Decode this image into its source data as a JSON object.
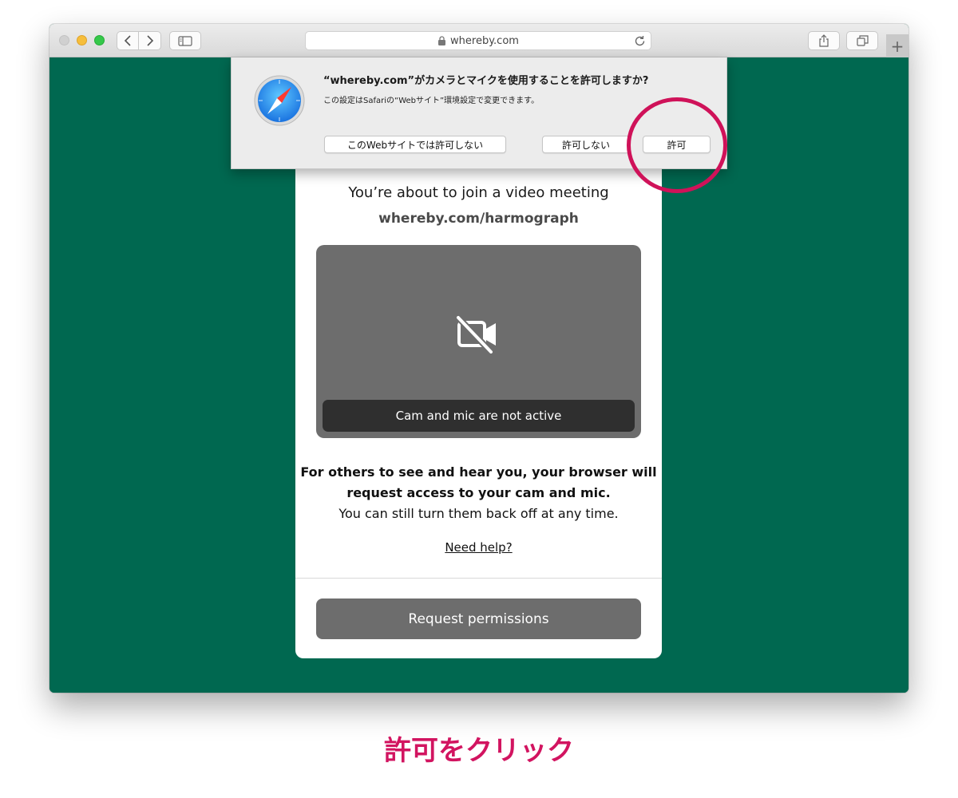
{
  "browser": {
    "address": "whereby.com",
    "new_tab_label": "+"
  },
  "permission_dialog": {
    "title": "“whereby.com”がカメラとマイクを使用することを許可しますか?",
    "subtitle": "この設定はSafariの“Webサイト”環境設定で変更できます。",
    "never_label": "このWebサイトでは許可しない",
    "deny_label": "許可しない",
    "allow_label": "許可"
  },
  "card": {
    "join_text": "You’re about to join a video meeting",
    "room_url": "whereby.com/harmograph",
    "preview_status": "Cam and mic are not active",
    "explain_line1": "For others to see and hear you, your browser will",
    "explain_line2": "request access to your cam and mic.",
    "explain_line3": "You can still turn them back off at any time.",
    "help_link": "Need help?",
    "request_button": "Request permissions"
  },
  "caption": "許可をクリック",
  "colors": {
    "page_background": "#006850",
    "highlight": "#cf1259",
    "button_gray": "#6d6d6d"
  }
}
